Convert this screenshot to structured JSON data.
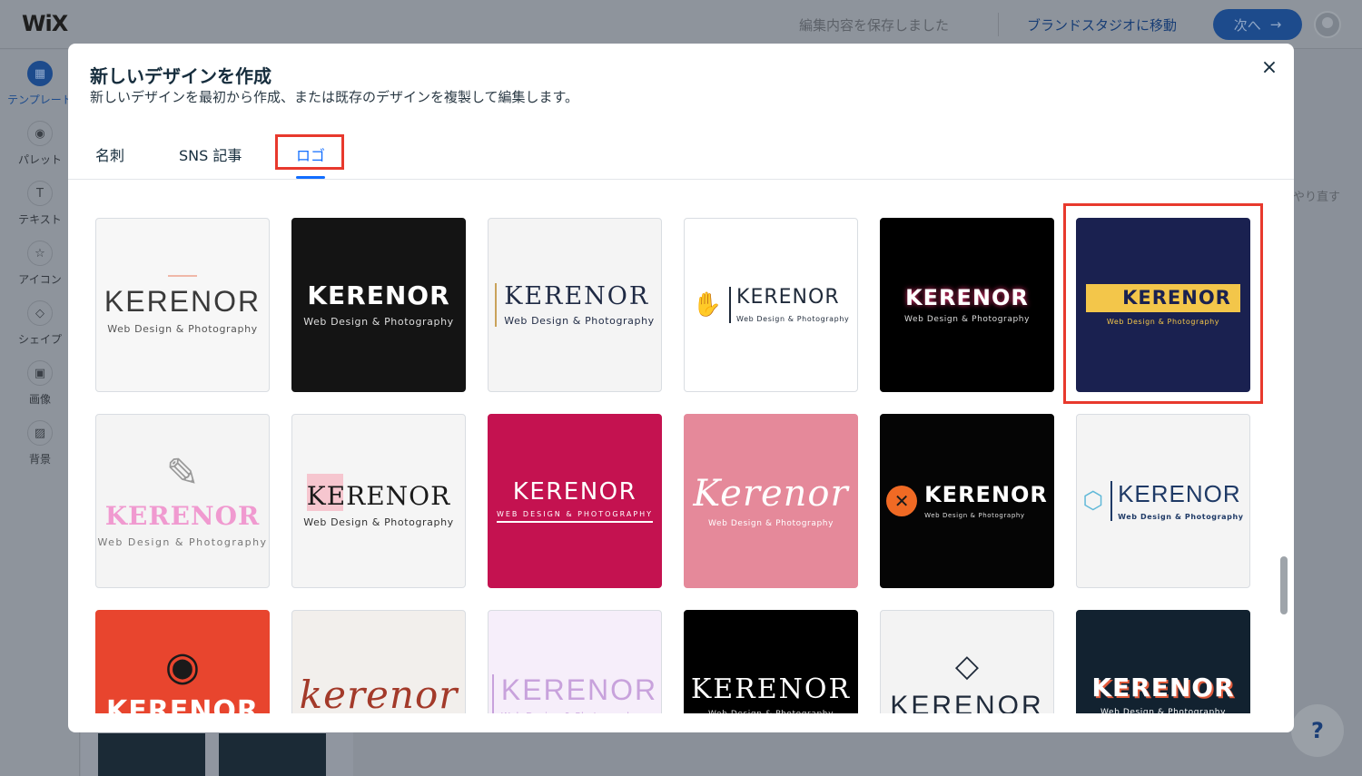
{
  "editor": {
    "logo": "WiX",
    "saved_status": "編集内容を保存しました",
    "brand_studio_link": "ブランドスタジオに移動",
    "next_button": "次へ",
    "next_arrow": "→",
    "undo_partial": "やり直す",
    "help": "?",
    "sidebar": [
      {
        "label": "テンプレート",
        "icon": "template-icon",
        "glyph": "▦",
        "active": true
      },
      {
        "label": "パレット",
        "icon": "palette-icon",
        "glyph": "◉",
        "active": false
      },
      {
        "label": "テキスト",
        "icon": "text-icon",
        "glyph": "T",
        "active": false
      },
      {
        "label": "アイコン",
        "icon": "star-icon",
        "glyph": "☆",
        "active": false
      },
      {
        "label": "シェイプ",
        "icon": "shapes-icon",
        "glyph": "◇",
        "active": false
      },
      {
        "label": "画像",
        "icon": "image-icon",
        "glyph": "▣",
        "active": false
      },
      {
        "label": "背景",
        "icon": "background-icon",
        "glyph": "▨",
        "active": false
      }
    ]
  },
  "modal": {
    "title": "新しいデザインを作成",
    "subtitle": "新しいデザインを最初から作成、または既存のデザインを複製して編集します。",
    "close": "×",
    "tabs": [
      {
        "label": "名刺",
        "active": false
      },
      {
        "label": "SNS 記事",
        "active": false
      },
      {
        "label": "ロゴ",
        "active": true
      }
    ],
    "logo_cards": [
      {
        "title": "KERENOR",
        "subtitle": "Web Design & Photography",
        "bg": "#f7f7f7",
        "fg": "#3a3a3a",
        "sub_fg": "#555555",
        "accent": "#f0b8a8"
      },
      {
        "title": "KERENOR",
        "subtitle": "Web Design & Photography",
        "bg": "#141414",
        "fg": "#ffffff",
        "sub_fg": "#dddddd",
        "accent": ""
      },
      {
        "title": "KERENOR",
        "subtitle": "Web Design & Photography",
        "bg": "#f4f4f4",
        "fg": "#1f2a44",
        "sub_fg": "#1f2a44",
        "accent": "#c9a25a"
      },
      {
        "title": "KERENOR",
        "subtitle": "Web Design & Photography",
        "bg": "#ffffff",
        "fg": "#1f2a3a",
        "sub_fg": "#1f2a3a",
        "accent": "#f07d3a"
      },
      {
        "title": "KERENOR",
        "subtitle": "Web Design & Photography",
        "bg": "#000000",
        "fg": "#ffffff",
        "sub_fg": "#dddddd",
        "accent": "#e0316e"
      },
      {
        "title": "KERENOR",
        "subtitle": "Web Design & Photography",
        "bg": "#1a2150",
        "fg": "#1a2150",
        "sub_fg": "#f3c64a",
        "accent": "#f3c64a"
      },
      {
        "title": "KERENOR",
        "subtitle": "Web Design & Photography",
        "bg": "#f4f4f4",
        "fg": "#f09ad0",
        "sub_fg": "#777777",
        "accent": "#9a9a9a"
      },
      {
        "title": "KERENOR",
        "subtitle": "Web Design & Photography",
        "bg": "#f5f5f5",
        "fg": "#1a1a1a",
        "sub_fg": "#333333",
        "accent": "#f6c6cf"
      },
      {
        "title": "KERENOR",
        "subtitle": "WEB DESIGN & PHOTOGRAPHY",
        "bg": "#c41250",
        "fg": "#ffffff",
        "sub_fg": "#ffffff",
        "accent": "#ffffff"
      },
      {
        "title": "Kerenor",
        "subtitle": "Web Design & Photography",
        "bg": "#e5899a",
        "fg": "#ffffff",
        "sub_fg": "#ffffff",
        "accent": ""
      },
      {
        "title": "KERENOR",
        "subtitle": "Web Design & Photography",
        "bg": "#050505",
        "fg": "#ffffff",
        "sub_fg": "#dddddd",
        "accent": "#f06a24"
      },
      {
        "title": "KERENOR",
        "subtitle": "Web Design & Photography",
        "bg": "#f4f4f4",
        "fg": "#1f3a66",
        "sub_fg": "#1f3a66",
        "accent": "#5fb8d8"
      },
      {
        "title": "KERENOR",
        "subtitle": "",
        "bg": "#e8452e",
        "fg": "#ffffff",
        "sub_fg": "#ffffff",
        "accent": "#1a1a1a"
      },
      {
        "title": "kerenor",
        "subtitle": "",
        "bg": "#f2efec",
        "fg": "#a33a2a",
        "sub_fg": "#a33a2a",
        "accent": ""
      },
      {
        "title": "KERENOR",
        "subtitle": "Web Design & Photography",
        "bg": "#f6eefa",
        "fg": "#c8a2dc",
        "sub_fg": "#c8a2dc",
        "accent": "#c8a2dc"
      },
      {
        "title": "KERENOR",
        "subtitle": "Web Design & Photography",
        "bg": "#000000",
        "fg": "#ffffff",
        "sub_fg": "#dddddd",
        "accent": ""
      },
      {
        "title": "KERENOR",
        "subtitle": "",
        "bg": "#f3f3f3",
        "fg": "#1f2a3a",
        "sub_fg": "#1f2a3a",
        "accent": "#1f2a3a"
      },
      {
        "title": "KERENOR",
        "subtitle": "Web Design & Photography",
        "bg": "#122230",
        "fg": "#ffffff",
        "sub_fg": "#ffffff",
        "accent": "#e05a3a"
      }
    ]
  }
}
